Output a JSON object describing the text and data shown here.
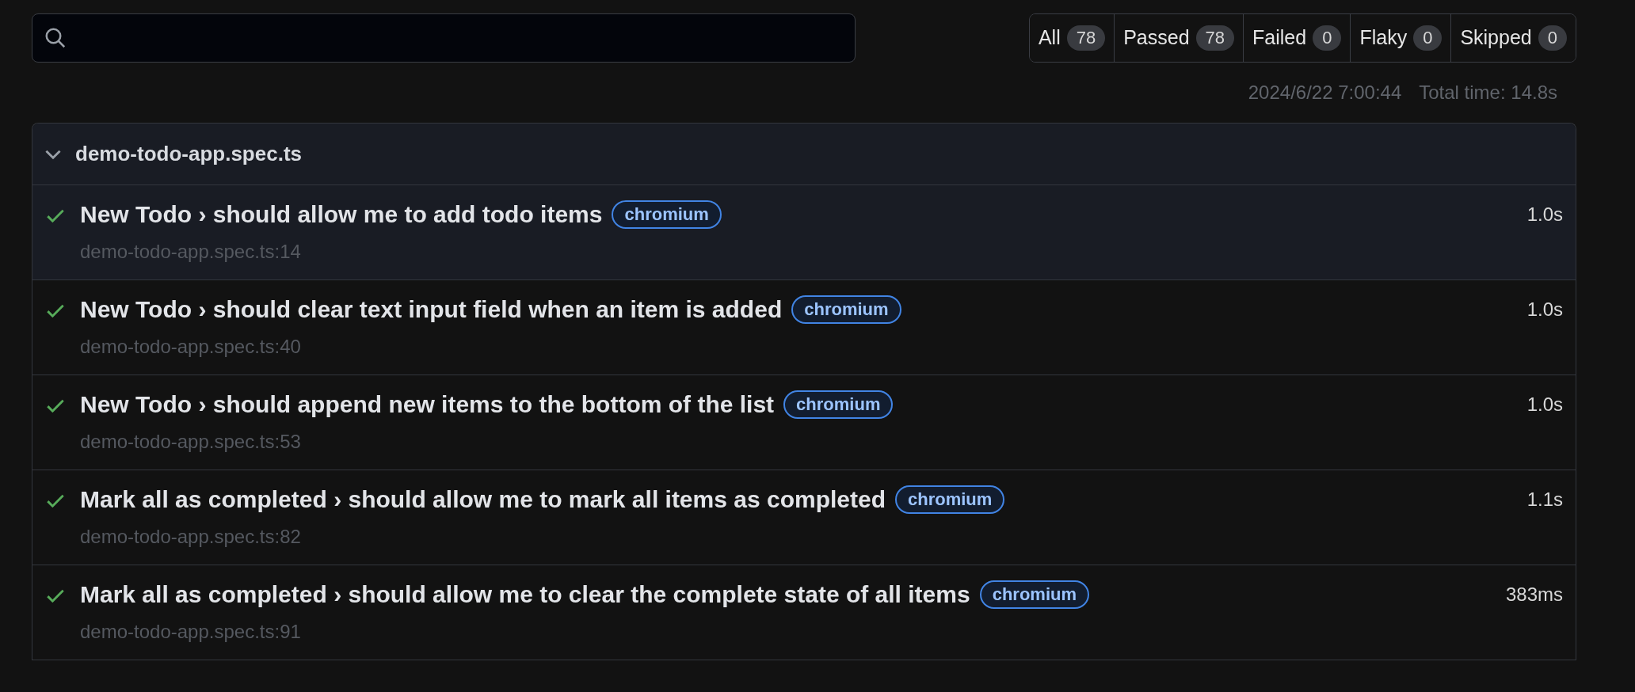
{
  "filters": [
    {
      "label": "All",
      "count": "78"
    },
    {
      "label": "Passed",
      "count": "78"
    },
    {
      "label": "Failed",
      "count": "0"
    },
    {
      "label": "Flaky",
      "count": "0"
    },
    {
      "label": "Skipped",
      "count": "0"
    }
  ],
  "run_info": {
    "date": "2024/6/22 7:00:44",
    "total_time": "Total time: 14.8s"
  },
  "file": {
    "name": "demo-todo-app.spec.ts",
    "expanded": true,
    "tests": [
      {
        "title": "New Todo › should allow me to add todo items",
        "tag": "chromium",
        "location": "demo-todo-app.spec.ts:14",
        "duration": "1.0s",
        "passed": true,
        "selected": true
      },
      {
        "title": "New Todo › should clear text input field when an item is added",
        "tag": "chromium",
        "location": "demo-todo-app.spec.ts:40",
        "duration": "1.0s",
        "passed": true,
        "selected": false
      },
      {
        "title": "New Todo › should append new items to the bottom of the list",
        "tag": "chromium",
        "location": "demo-todo-app.spec.ts:53",
        "duration": "1.0s",
        "passed": true,
        "selected": false
      },
      {
        "title": "Mark all as completed › should allow me to mark all items as completed",
        "tag": "chromium",
        "location": "demo-todo-app.spec.ts:82",
        "duration": "1.1s",
        "passed": true,
        "selected": false
      },
      {
        "title": "Mark all as completed › should allow me to clear the complete state of all items",
        "tag": "chromium",
        "location": "demo-todo-app.spec.ts:91",
        "duration": "383ms",
        "passed": true,
        "selected": false
      }
    ]
  }
}
